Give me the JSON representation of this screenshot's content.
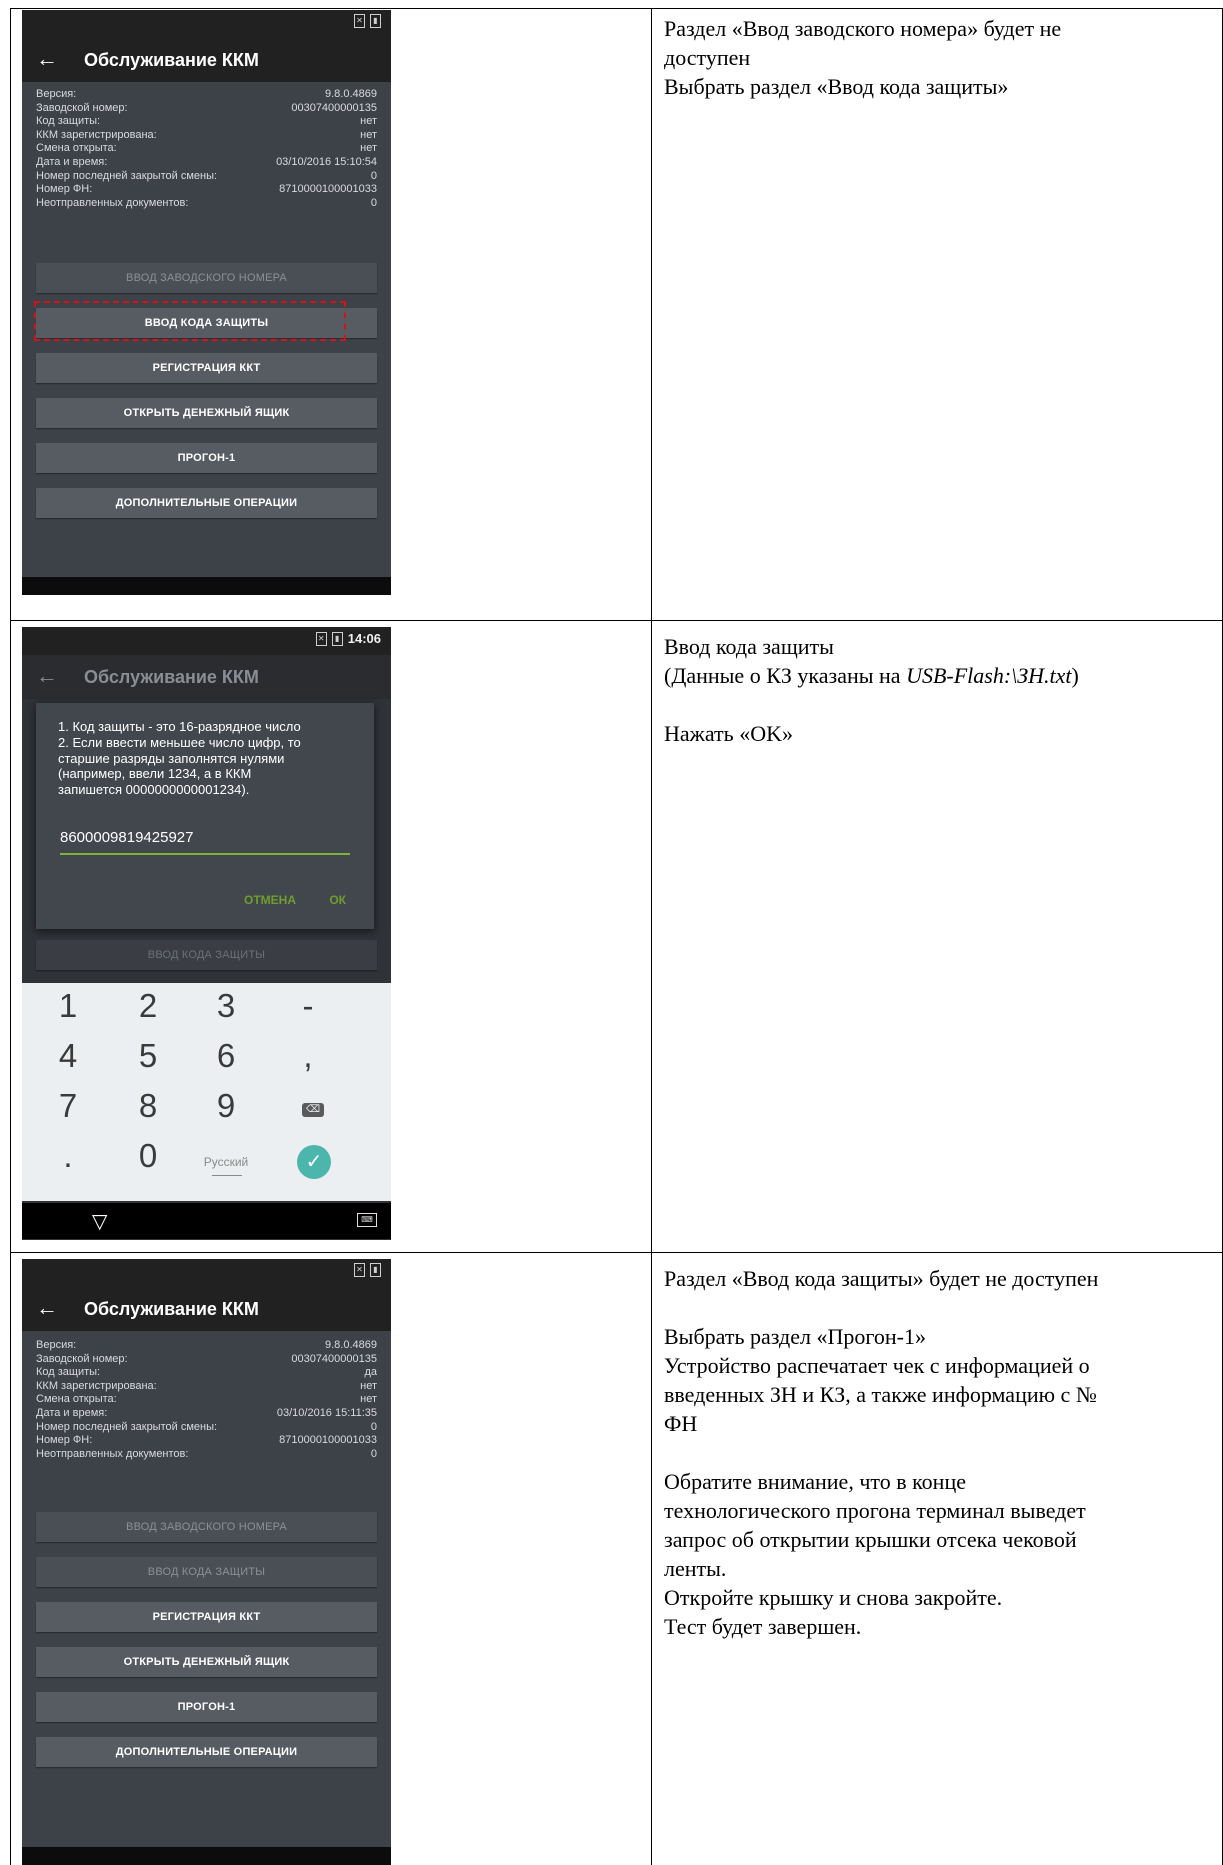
{
  "rows": [
    {
      "screen": {
        "title": "Обслуживание ККМ",
        "info": [
          {
            "k": "Версия:",
            "v": "9.8.0.4869"
          },
          {
            "k": "Заводской номер:",
            "v": "00307400000135"
          },
          {
            "k": "Код защиты:",
            "v": "нет"
          },
          {
            "k": "ККМ зарегистрирована:",
            "v": "нет"
          },
          {
            "k": "Смена открыта:",
            "v": "нет"
          },
          {
            "k": "Дата и время:",
            "v": "03/10/2016 15:10:54"
          },
          {
            "k": "Номер последней закрытой смены:",
            "v": "0"
          },
          {
            "k": "Номер ФН:",
            "v": "8710000100001033"
          },
          {
            "k": "Неотправленных документов:",
            "v": "0"
          }
        ],
        "buttons": [
          {
            "label": "ВВОД ЗАВОДСКОГО НОМЕРА",
            "enabled": false
          },
          {
            "label": "ВВОД КОДА ЗАЩИТЫ",
            "enabled": true
          },
          {
            "label": "РЕГИСТРАЦИЯ ККТ",
            "enabled": true
          },
          {
            "label": "ОТКРЫТЬ ДЕНЕЖНЫЙ ЯЩИК",
            "enabled": true
          },
          {
            "label": "ПРОГОН-1",
            "enabled": true
          },
          {
            "label": "ДОПОЛНИТЕЛЬНЫЕ ОПЕРАЦИИ",
            "enabled": true
          }
        ]
      },
      "instructions": [
        "Раздел «Ввод заводского номера» будет не",
        "доступен",
        "Выбрать раздел «Ввод кода защиты»"
      ]
    },
    {
      "screen": {
        "time": "14:06",
        "title": "Обслуживание ККМ",
        "dialog_lines": [
          "1. Код защиты - это 16-разрядное число",
          "2. Если ввести меньшее число цифр, то",
          "старшие разряды заполнятся нулями",
          "(например, ввели 1234, а в ККМ",
          "запишется 0000000000001234)."
        ],
        "code_value": "8600009819425927",
        "cancel_label": "ОТМЕНА",
        "ok_label": "ОК",
        "behind_button": "ВВОД КОДА ЗАЩИТЫ",
        "keys": [
          "1",
          "2",
          "3",
          "-",
          "4",
          "5",
          "6",
          ",",
          "7",
          "8",
          "9",
          "⌫",
          ".",
          "0",
          "Русский",
          "✓"
        ]
      },
      "instructions": {
        "line1": "Ввод кода защиты",
        "line2_prefix": "(Данные о КЗ указаны на ",
        "line2_italic": "USB-Flash:\\ЗН.txt",
        "line2_suffix": ")",
        "line4": "Нажать «OK»"
      }
    },
    {
      "screen": {
        "title": "Обслуживание ККМ",
        "info": [
          {
            "k": "Версия:",
            "v": "9.8.0.4869"
          },
          {
            "k": "Заводской номер:",
            "v": "00307400000135"
          },
          {
            "k": "Код защиты:",
            "v": "да"
          },
          {
            "k": "ККМ зарегистрирована:",
            "v": "нет"
          },
          {
            "k": "Смена открыта:",
            "v": "нет"
          },
          {
            "k": "Дата и время:",
            "v": "03/10/2016 15:11:35"
          },
          {
            "k": "Номер последней закрытой смены:",
            "v": "0"
          },
          {
            "k": "Номер ФН:",
            "v": "8710000100001033"
          },
          {
            "k": "Неотправленных документов:",
            "v": "0"
          }
        ],
        "buttons": [
          {
            "label": "ВВОД ЗАВОДСКОГО НОМЕРА",
            "enabled": false
          },
          {
            "label": "ВВОД КОДА ЗАЩИТЫ",
            "enabled": false
          },
          {
            "label": "РЕГИСТРАЦИЯ ККТ",
            "enabled": true
          },
          {
            "label": "ОТКРЫТЬ ДЕНЕЖНЫЙ ЯЩИК",
            "enabled": true
          },
          {
            "label": "ПРОГОН-1",
            "enabled": true
          },
          {
            "label": "ДОПОЛНИТЕЛЬНЫЕ ОПЕРАЦИИ",
            "enabled": true
          }
        ]
      },
      "instructions": [
        "Раздел «Ввод кода защиты» будет не доступен",
        "",
        "Выбрать раздел «Прогон-1»",
        "Устройство распечатает чек с информацией о",
        "введенных ЗН и КЗ, а также информацию с №",
        "ФН",
        "",
        "Обратите внимание, что в конце",
        "технологического прогона терминал выведет",
        "запрос об открытии крышки отсека чековой",
        "ленты.",
        "Откройте крышку и снова закройте.",
        "Тест будет завершен."
      ]
    }
  ],
  "colors": {
    "screen_bg": "#3d4148",
    "highlight_dash": "#d0141c",
    "dialog_accent": "#6f9e2e",
    "enter_key": "#4db6ac"
  }
}
